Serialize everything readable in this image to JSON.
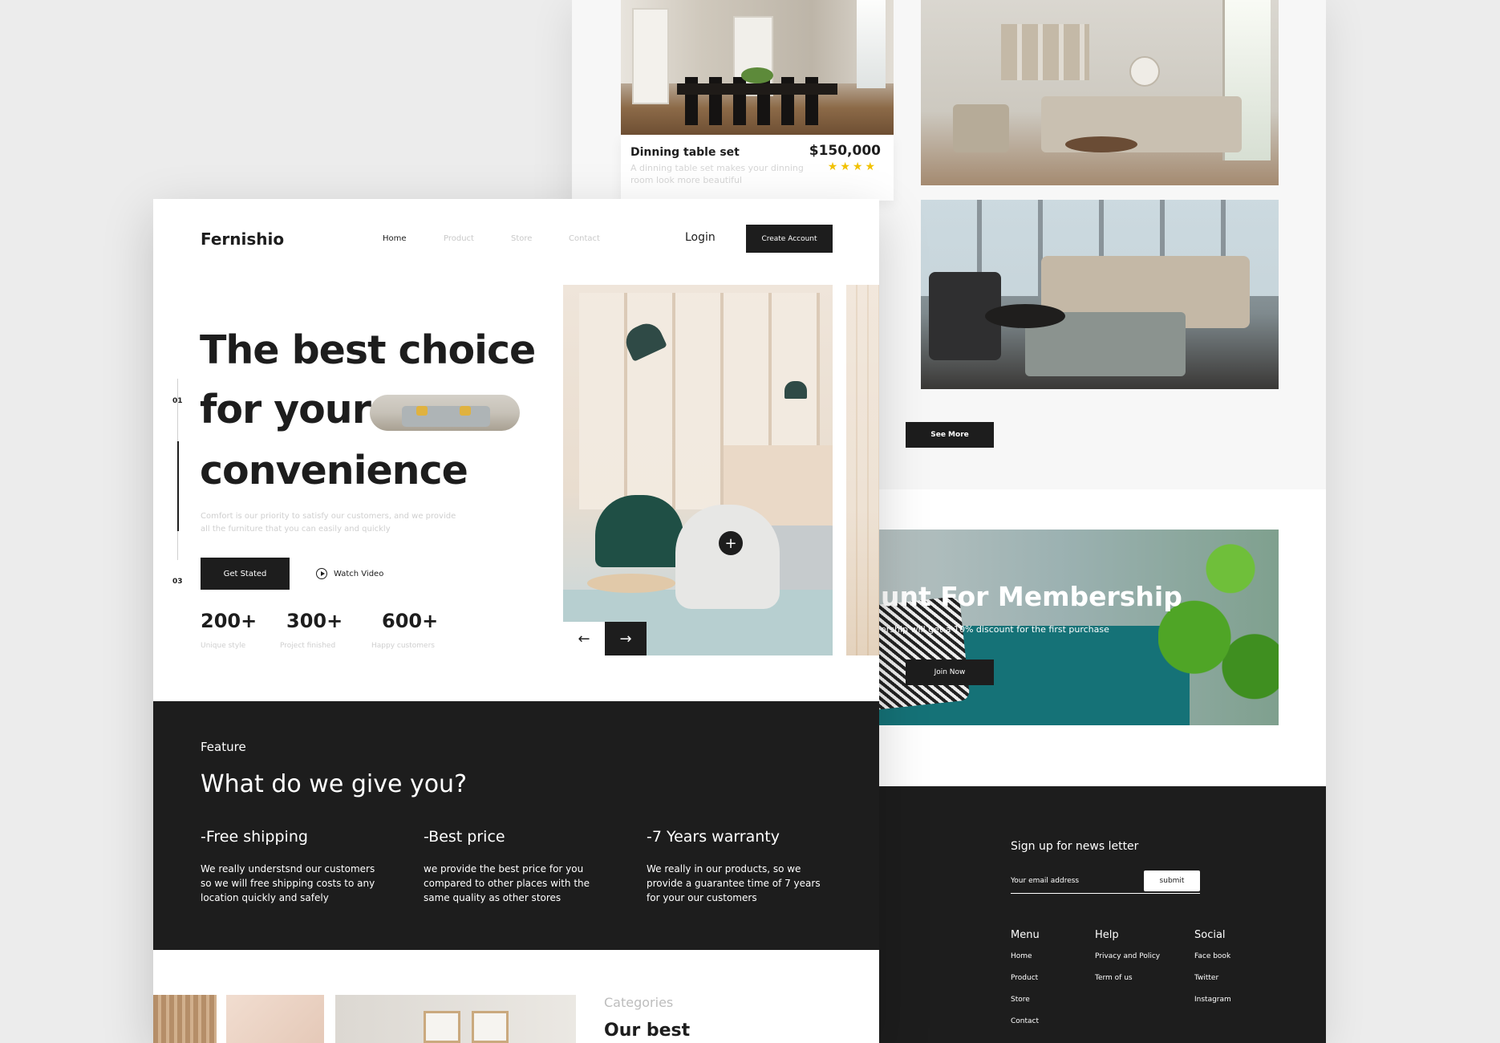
{
  "back_page": {
    "product_card": {
      "title": "Dinning table set",
      "price": "$150,000",
      "description": "A dinning table set makes your dinning room look more beautiful",
      "rating_stars": 4,
      "stars_text": "★★★★"
    },
    "see_more_label": "See More",
    "membership": {
      "title": "unt For Membership",
      "subtitle": "ership will get a 10% discount for the first purchase",
      "join_label": "Join Now"
    },
    "footer": {
      "newsletter_title": "Sign up for news letter",
      "email_placeholder": "Your email address",
      "submit_label": "submit",
      "menu": {
        "title": "Menu",
        "items": [
          "Home",
          "Product",
          "Store",
          "Contact"
        ]
      },
      "help": {
        "title": "Help",
        "items": [
          "Privacy and Policy",
          "Term of us"
        ]
      },
      "social": {
        "title": "Social",
        "items": [
          "Face book",
          "Twitter",
          "Instagram"
        ]
      }
    }
  },
  "front_page": {
    "logo": "Fernishio",
    "nav": [
      "Home",
      "Product",
      "Store",
      "Contact"
    ],
    "login_label": "Login",
    "create_account_label": "Create Account",
    "slide_indicator": {
      "start": "01",
      "end": "03"
    },
    "hero": {
      "line1": "The best choice",
      "line2": "for your",
      "line3": "convenience",
      "description": "Comfort is our priority to satisfy our customers, and we provide all the furniture that you can easily and quickly",
      "cta_label": "Get Stated",
      "watch_label": "Watch Video"
    },
    "stats": [
      {
        "value": "200+",
        "label": "Unique style"
      },
      {
        "value": "300+",
        "label": "Project finished"
      },
      {
        "value": "600+",
        "label": "Happy customers"
      }
    ],
    "gallery_controls": {
      "plus": "+",
      "prev": "←",
      "next": "→"
    },
    "feature": {
      "label": "Feature",
      "heading": "What do we give you?",
      "items": [
        {
          "title": "-Free shipping",
          "text": "We really understsnd our customers so we will free shipping costs to any location quickly and safely"
        },
        {
          "title": "-Best price",
          "text": "we provide the best price for you compared to other places with the same quality as other stores"
        },
        {
          "title": "-7 Years warranty",
          "text": "We really in our products, so we provide a guarantee time of 7 years for your our customers"
        }
      ]
    },
    "categories": {
      "label": "Categories",
      "title": "Our best"
    }
  },
  "colors": {
    "dark": "#1d1d1d",
    "muted": "#cfcfcf",
    "star": "#f2c200",
    "background": "#ececec"
  }
}
